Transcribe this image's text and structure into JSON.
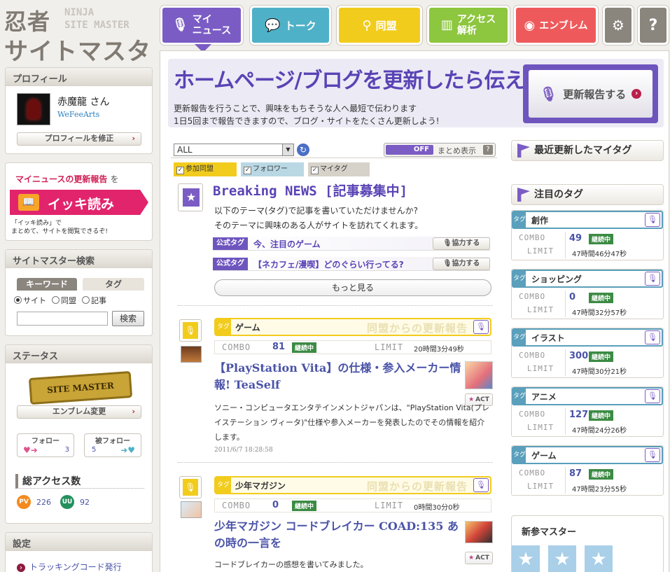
{
  "logo": {
    "line1": "忍者",
    "line2": "サイトマスター",
    "sub1": "NINJA",
    "sub2": "SITE MASTER"
  },
  "nav": {
    "mynews": "マイ\nニュース",
    "mynews_top": "マイ",
    "mynews_bottom": "ニュース",
    "talk": "トーク",
    "domei": "同盟",
    "access_top": "アクセス",
    "access_bottom": "解析",
    "emblem": "エンブレム",
    "help": "?"
  },
  "profile": {
    "header": "プロフィール",
    "name": "赤魔龍 さん",
    "site": "WeFeeArts",
    "edit_label": "プロフィールを修正"
  },
  "mynews_box": {
    "title": "マイニュースの更新報告",
    "title_suffix": "を",
    "button": "イッキ読み",
    "note1": "「イッキ読み」で",
    "note2": "まとめて、サイトを閲覧できるぞ!"
  },
  "search": {
    "header": "サイトマスター検索",
    "tab_keyword": "キーワード",
    "tab_tag": "タグ",
    "opt_site": "サイト",
    "opt_domei": "同盟",
    "opt_article": "記事",
    "button": "検索",
    "value": ""
  },
  "status": {
    "header": "ステータス",
    "emblem_text": "SITE MASTER",
    "emblem_button": "エンブレム変更",
    "follow_label": "フォロー",
    "follow_count": "3",
    "followed_label": "被フォロー",
    "followed_count": "5",
    "access_title": "総アクセス数",
    "pv_label": "PV",
    "pv_value": "226",
    "uu_label": "UU",
    "uu_value": "92"
  },
  "settings": {
    "header": "設定",
    "tracking": "トラッキングコード発行"
  },
  "banner": {
    "headline": "ホームページ/ブログを更新したら伝えよう",
    "line1": "更新報告を行うことで、興味をもちそうな人へ最短で伝わります",
    "line2": "1日5回まで報告できますので、ブログ・サイトをたくさん更新しよう!",
    "button": "更新報告する"
  },
  "feed": {
    "filter_value": "ALL",
    "toggle": "OFF",
    "matome_label": "まとめ表示",
    "tabs": [
      "参加同盟",
      "フォロワー",
      "マイタグ"
    ],
    "breaking": {
      "title": "Breaking NEWS [記事募集中]",
      "desc1": "以下のテーマ(タグ)で記事を書いていただけませんか?",
      "desc2": "そのテーマに興味のある人がサイトを訪れてくれます。",
      "rows": [
        {
          "badge": "公式タグ",
          "text": "今、注目のゲーム",
          "button": "協力する"
        },
        {
          "badge": "公式タグ",
          "text": "【ネカフェ/漫喫】どのぐらい行ってる?",
          "button": "協力する"
        }
      ],
      "more": "もっと見る"
    },
    "posts": [
      {
        "tag_prefix": "タグ",
        "tag": "ゲーム",
        "report_label": "同盟からの更新報告",
        "combo_label": "COMBO",
        "combo": "81",
        "combo_status": "継続中",
        "limit_label": "LIMIT",
        "limit": "20時間3分49秒",
        "title": "【PlayStation Vita】の仕様・参入メーカー情報! TeaSelf",
        "body": "ソニー・コンピュータエンタテインメントジャパンは、\"PlayStation Vita(プレイステーション ヴィータ)\"仕様や参入メーカーを発表したのでその情報を紹介します。",
        "date": "2011/6/7 18:28:58",
        "act": "ACT"
      },
      {
        "tag_prefix": "タグ",
        "tag": "少年マガジン",
        "report_label": "同盟からの更新報告",
        "combo_label": "COMBO",
        "combo": "0",
        "combo_status": "継続中",
        "limit_label": "LIMIT",
        "limit": "0時間30分0秒",
        "title": "少年マガジン コードブレイカー COAD:135 あの時の一言を",
        "body": "コードブレイカーの感想を書いてみました。",
        "act": "ACT"
      }
    ]
  },
  "right": {
    "recent_title": "最近更新したマイタグ",
    "hot_title": "注目のタグ",
    "tag_prefix": "タグ",
    "combo_label": "COMBO",
    "limit_label": "LIMIT",
    "status": "継続中",
    "tags": [
      {
        "name": "創作",
        "combo": "49",
        "limit": "47時間46分47秒"
      },
      {
        "name": "ショッピング",
        "combo": "0",
        "limit": "47時間32分57秒"
      },
      {
        "name": "イラスト",
        "combo": "300",
        "limit": "47時間30分21秒"
      },
      {
        "name": "アニメ",
        "combo": "127",
        "limit": "47時間24分26秒"
      },
      {
        "name": "ゲーム",
        "combo": "87",
        "limit": "47時間23分55秒"
      }
    ],
    "new_master_title": "新参マスター"
  }
}
